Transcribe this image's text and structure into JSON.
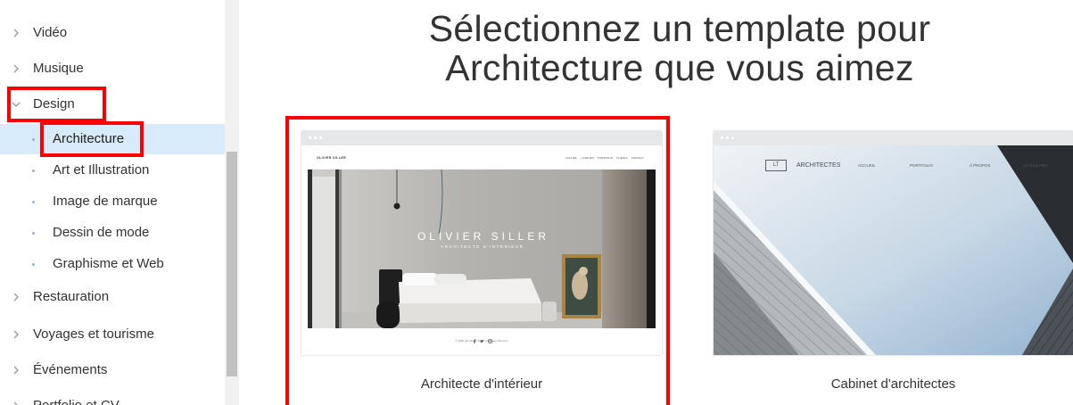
{
  "sidebar": {
    "categories": [
      {
        "label": "Vidéo",
        "expanded": false
      },
      {
        "label": "Musique",
        "expanded": false
      },
      {
        "label": "Design",
        "expanded": true,
        "annotated": true,
        "subcategories": [
          {
            "label": "Architecture",
            "selected": true,
            "annotated": true
          },
          {
            "label": "Art et Illustration",
            "selected": false
          },
          {
            "label": "Image de marque",
            "selected": false
          },
          {
            "label": "Dessin de mode",
            "selected": false
          },
          {
            "label": "Graphisme et Web",
            "selected": false
          }
        ]
      },
      {
        "label": "Restauration",
        "expanded": false
      },
      {
        "label": "Voyages et tourisme",
        "expanded": false
      },
      {
        "label": "Événements",
        "expanded": false
      },
      {
        "label": "Portfolio et CV",
        "expanded": false
      }
    ],
    "icons": {
      "collapsed": "chevron-right-icon",
      "expanded": "chevron-down-icon",
      "subcategory": "bullet-icon"
    }
  },
  "main": {
    "heading": [
      "Sélectionnez un template pour",
      "Architecture que vous aimez"
    ],
    "templates": [
      {
        "name": "Architecte d'intérieur",
        "annotated": true,
        "preview": {
          "site_title": "OLIVIER SILLER",
          "nav": [
            "ACCUEIL",
            "L'ATELIER",
            "PORTFOLIO",
            "CLIENTS",
            "CONTACT"
          ],
          "hero_title": "OLIVIER SILLER",
          "hero_subtitle": "ARCHITECTE D'INTÉRIEUR",
          "social_icons": [
            "facebook-icon",
            "twitter-icon",
            "instagram-icon"
          ],
          "footer_text": "© 2035 par Olivier Siller. Créé avec Wix.com"
        }
      },
      {
        "name": "Cabinet d'architectes",
        "annotated": false,
        "preview": {
          "logo_mark": "LT",
          "site_title": "ARCHITECTES",
          "nav": [
            "ACCUEIL",
            "PORTFOLIO",
            "À PROPOS",
            "ACTUALITÉS"
          ]
        }
      }
    ]
  },
  "theme": {
    "text": "#333333",
    "selection_bg": "#d8ebfa",
    "annotation": "#ff0000",
    "scrollbar_thumb": "#c1c1c1"
  }
}
